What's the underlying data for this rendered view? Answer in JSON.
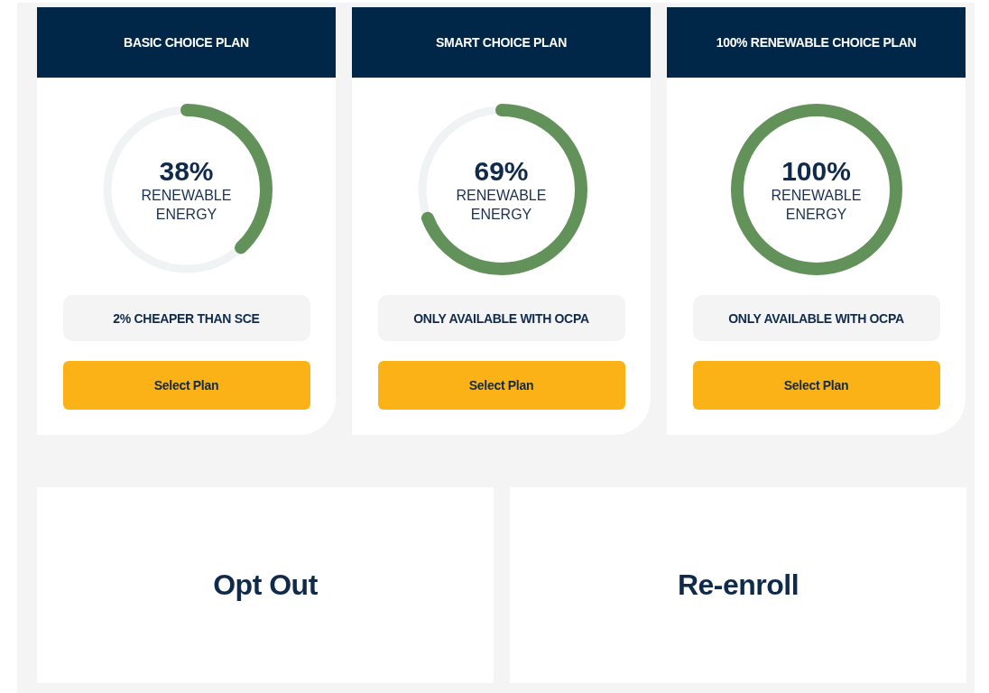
{
  "plans": [
    {
      "title": "BASIC CHOICE PLAN",
      "level": 0.38,
      "percent": "38%",
      "caption": "RENEWABLE ENERGY",
      "note": "2% CHEAPER THAN SCE",
      "button": "Select Plan"
    },
    {
      "title": "SMART CHOICE PLAN",
      "level": 0.69,
      "percent": "69%",
      "caption": "RENEWABLE ENERGY",
      "note": "ONLY AVAILABLE WITH OCPA",
      "button": "Select Plan"
    },
    {
      "title": "100% RENEWABLE CHOICE PLAN",
      "level": 1,
      "percent": "100%",
      "caption": "RENEWABLE ENERGY",
      "note": "ONLY AVAILABLE WITH OCPA",
      "button": "Select Plan"
    }
  ],
  "actions": [
    "Opt Out",
    "Re-enroll"
  ]
}
